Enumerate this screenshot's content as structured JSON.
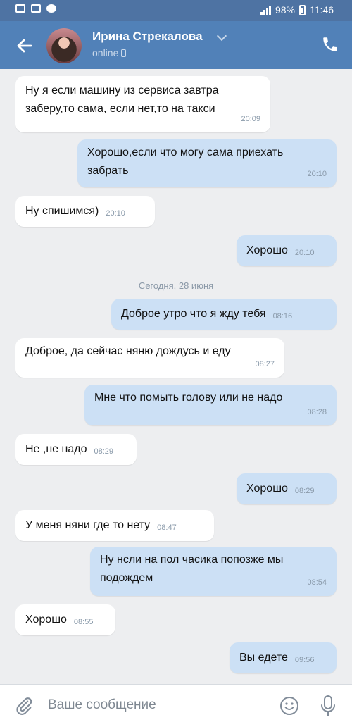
{
  "status_bar": {
    "battery": "98%",
    "time": "11:46"
  },
  "header": {
    "contact_name": "Ирина Стрекалова",
    "status": "online"
  },
  "date_separator": "Сегодня, 28 июня",
  "messages": [
    {
      "dir": "in",
      "text": "Ну я если машину из сервиса завтра\nзаберу,то сама, если нет,то на такси",
      "time": "20:09"
    },
    {
      "dir": "out",
      "text": "Хорошо,если что могу сама приехать\nзабрать",
      "time": "20:10"
    },
    {
      "dir": "in",
      "text": "Ну спишимся)",
      "time": "20:10"
    },
    {
      "dir": "out",
      "text": "Хорошо",
      "time": "20:10"
    },
    {
      "dir": "out",
      "text": "Доброе утро что я жду тебя",
      "time": "08:16"
    },
    {
      "dir": "in",
      "text": "Доброе, да сейчас няню дождусь и еду",
      "time": "08:27"
    },
    {
      "dir": "out",
      "text": "Мне что помыть голову или не надо",
      "time": "08:28"
    },
    {
      "dir": "in",
      "text": "Не ,не надо",
      "time": "08:29"
    },
    {
      "dir": "out",
      "text": "Хорошо",
      "time": "08:29"
    },
    {
      "dir": "in",
      "text": "У меня няни где то нету",
      "time": "08:47"
    },
    {
      "dir": "out",
      "text": "Ну нсли на пол часика попозже мы\nподождем",
      "time": "08:54"
    },
    {
      "dir": "in",
      "text": "Хорошо",
      "time": "08:55"
    },
    {
      "dir": "out",
      "text": "Вы едете",
      "time": "09:56"
    }
  ],
  "input": {
    "placeholder": "Ваше сообщение"
  },
  "colors": {
    "header": "#5181b8",
    "outgoing_bubble": "#cce0f5",
    "incoming_bubble": "#ffffff",
    "background": "#edeef0"
  }
}
